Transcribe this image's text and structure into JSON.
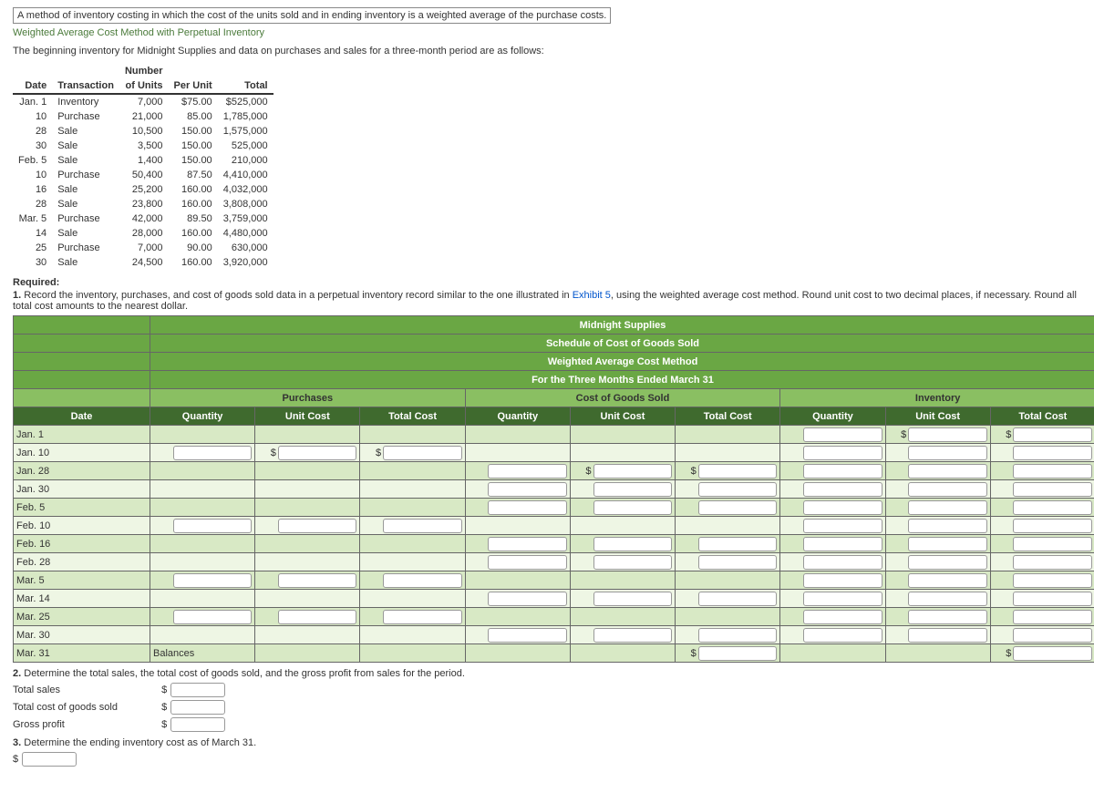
{
  "tooltip": "A method of inventory costing in which the cost of the units sold and in ending inventory is a weighted average of the purchase costs.",
  "sectionTitle": "Weighted Average Cost Method with Perpetual Inventory",
  "intro": "The beginning inventory for Midnight Supplies and data on purchases and sales for a three-month period are as follows:",
  "table": {
    "h1": "Date",
    "h2": "Transaction",
    "h3a": "Number",
    "h3b": "of Units",
    "h4": "Per Unit",
    "h5": "Total",
    "rows": [
      {
        "d": "Jan. 1",
        "t": "Inventory",
        "u": "7,000",
        "p": "$75.00",
        "tot": "$525,000"
      },
      {
        "d": "10",
        "t": "Purchase",
        "u": "21,000",
        "p": "85.00",
        "tot": "1,785,000"
      },
      {
        "d": "28",
        "t": "Sale",
        "u": "10,500",
        "p": "150.00",
        "tot": "1,575,000"
      },
      {
        "d": "30",
        "t": "Sale",
        "u": "3,500",
        "p": "150.00",
        "tot": "525,000"
      },
      {
        "d": "Feb. 5",
        "t": "Sale",
        "u": "1,400",
        "p": "150.00",
        "tot": "210,000"
      },
      {
        "d": "10",
        "t": "Purchase",
        "u": "50,400",
        "p": "87.50",
        "tot": "4,410,000"
      },
      {
        "d": "16",
        "t": "Sale",
        "u": "25,200",
        "p": "160.00",
        "tot": "4,032,000"
      },
      {
        "d": "28",
        "t": "Sale",
        "u": "23,800",
        "p": "160.00",
        "tot": "3,808,000"
      },
      {
        "d": "Mar. 5",
        "t": "Purchase",
        "u": "42,000",
        "p": "89.50",
        "tot": "3,759,000"
      },
      {
        "d": "14",
        "t": "Sale",
        "u": "28,000",
        "p": "160.00",
        "tot": "4,480,000"
      },
      {
        "d": "25",
        "t": "Purchase",
        "u": "7,000",
        "p": "90.00",
        "tot": "630,000"
      },
      {
        "d": "30",
        "t": "Sale",
        "u": "24,500",
        "p": "160.00",
        "tot": "3,920,000"
      }
    ]
  },
  "requiredLabel": "Required:",
  "req1a": "1.",
  "req1b": "Record the inventory, purchases, and cost of goods sold data in a perpetual inventory record similar to the one illustrated in ",
  "req1link": "Exhibit 5",
  "req1c": ", using the weighted average cost method. Round unit cost to two decimal places, if necessary. Round all total cost amounts to the nearest dollar.",
  "sched": {
    "h1": "Midnight Supplies",
    "h2": "Schedule of Cost of Goods Sold",
    "h3": "Weighted Average Cost Method",
    "h4": "For the Three Months Ended March 31",
    "grpDate": "Date",
    "grpPurch": "Purchases",
    "grpCogs": "Cost of Goods Sold",
    "grpInv": "Inventory",
    "colQty": "Quantity",
    "colUC": "Unit Cost",
    "colTC": "Total Cost",
    "dates": [
      "Jan. 1",
      "Jan. 10",
      "Jan. 28",
      "Jan. 30",
      "Feb. 5",
      "Feb. 10",
      "Feb. 16",
      "Feb. 28",
      "Mar. 5",
      "Mar. 14",
      "Mar. 25",
      "Mar. 30",
      "Mar. 31"
    ],
    "balances": "Balances"
  },
  "req2a": "2.",
  "req2b": "Determine the total sales, the total cost of goods sold, and the gross profit from sales for the period.",
  "q2rows": {
    "ts": "Total sales",
    "tcogs": "Total cost of goods sold",
    "gp": "Gross profit"
  },
  "req3a": "3.",
  "req3b": "Determine the ending inventory cost as of March 31.",
  "dollar": "$"
}
